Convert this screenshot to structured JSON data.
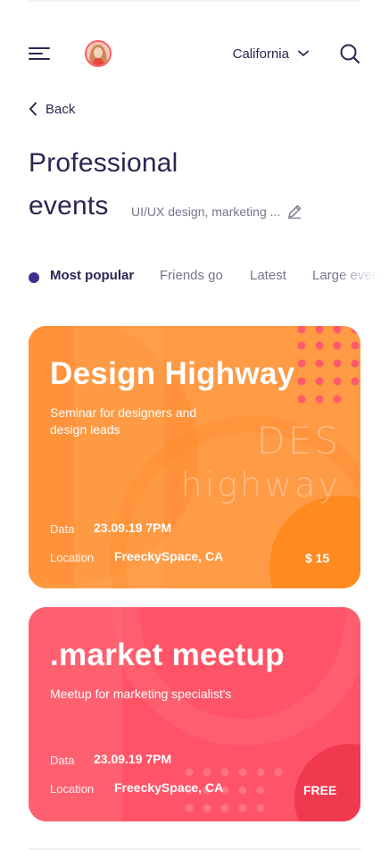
{
  "header": {
    "location": "California",
    "icons": {
      "menu": "hamburger-menu-icon",
      "search": "search-icon",
      "chevron": "chevron-down-icon"
    }
  },
  "nav": {
    "back_label": "Back"
  },
  "page": {
    "title_line1": "Professional",
    "title_line2": "events",
    "tags": "UI/UX design, marketing ..."
  },
  "filters": [
    {
      "label": "Most popular",
      "active": true
    },
    {
      "label": "Friends go",
      "active": false
    },
    {
      "label": "Latest",
      "active": false
    },
    {
      "label": "Large events",
      "active": false
    }
  ],
  "events": [
    {
      "title": "Design Highway",
      "description": "Seminar for designers and design leads",
      "watermark_line1": "DES",
      "watermark_line2": "highway",
      "date_label": "Data",
      "date": "23.09.19 7PM",
      "location_label": "Location",
      "location": "FreeckySpace, CA",
      "price": "$ 15",
      "colors": {
        "base": "#ff9a45",
        "accent": "#ff8a2a",
        "dots": "#ff5a6a"
      }
    },
    {
      "title": ".market meetup",
      "description": "Meetup for marketing specialist's",
      "date_label": "Data",
      "date": "23.09.19 7PM",
      "location_label": "Location",
      "location": "FreeckySpace, CA",
      "price": "FREE",
      "colors": {
        "base": "#ff5467",
        "accent": "#f03a50",
        "dots": "#ff7a88"
      }
    }
  ],
  "colors": {
    "text_primary": "#2b2650",
    "text_secondary": "#77748f",
    "accent": "#3f2d8f"
  }
}
